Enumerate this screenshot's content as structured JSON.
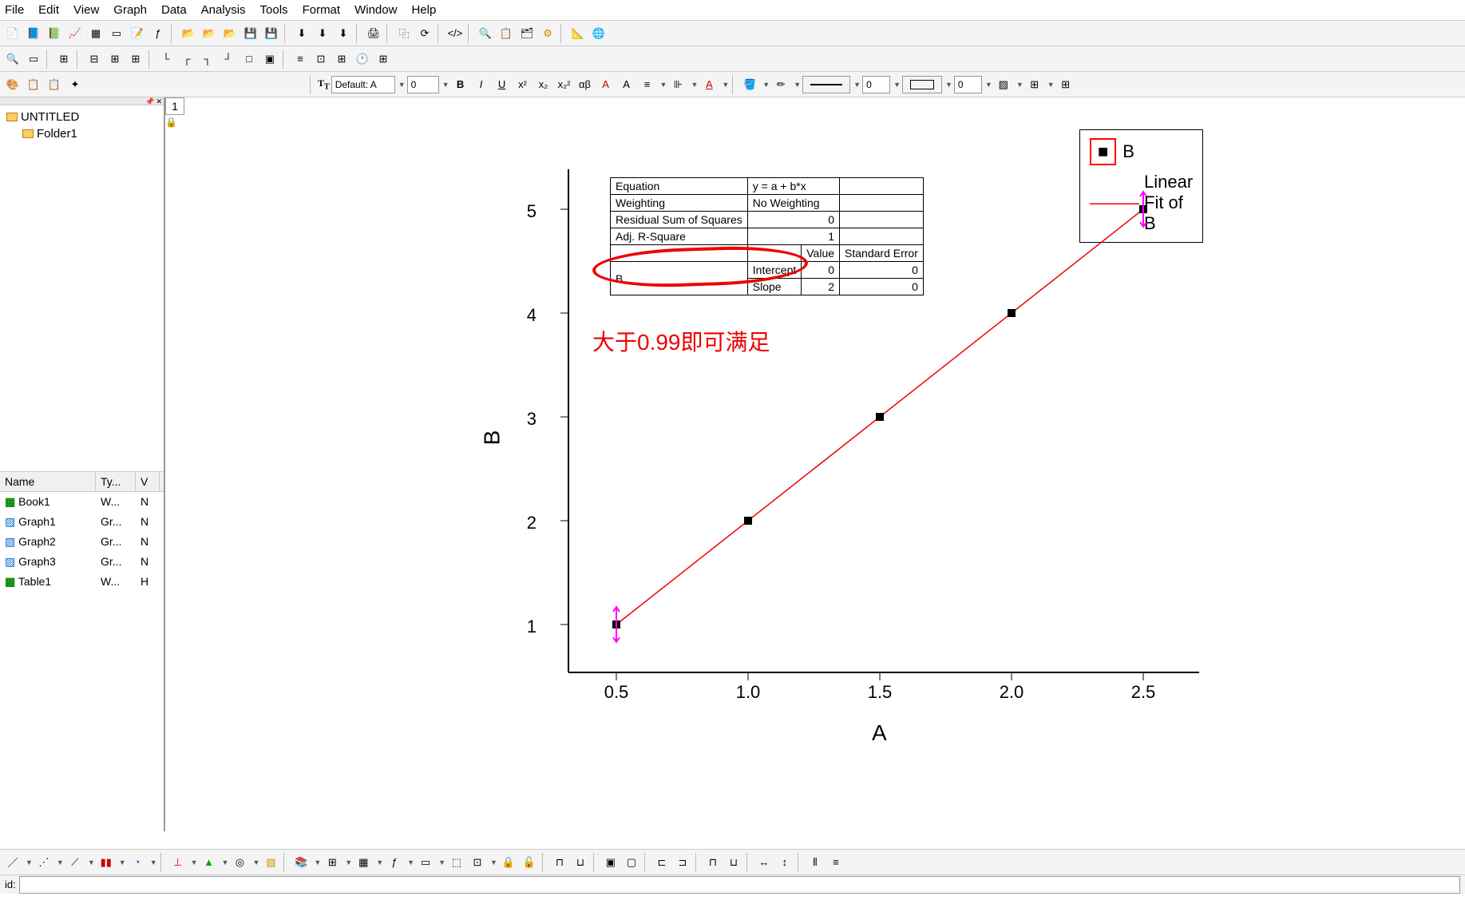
{
  "menu": {
    "items": [
      "File",
      "Edit",
      "View",
      "Graph",
      "Data",
      "Analysis",
      "Tools",
      "Format",
      "Window",
      "Help"
    ]
  },
  "format_toolbar": {
    "font_label": "Default: A",
    "size_value": "0",
    "line_width": "0",
    "border_width": "0"
  },
  "tree": {
    "root": "UNTITLED",
    "folder": "Folder1"
  },
  "list": {
    "headers": [
      "Name",
      "Ty...",
      "V"
    ],
    "rows": [
      {
        "name": "Book1",
        "type": "W...",
        "v": "N"
      },
      {
        "name": "Graph1",
        "type": "Gr...",
        "v": "N"
      },
      {
        "name": "Graph2",
        "type": "Gr...",
        "v": "N"
      },
      {
        "name": "Graph3",
        "type": "Gr...",
        "v": "N"
      },
      {
        "name": "Table1",
        "type": "W...",
        "v": "H"
      }
    ]
  },
  "graph": {
    "page": "1",
    "legend": {
      "series1": "B",
      "series2": "Linear Fit of B"
    },
    "xlabel": "A",
    "ylabel": "B",
    "xticks": [
      "0.5",
      "1.0",
      "1.5",
      "2.0",
      "2.5"
    ],
    "yticks": [
      "1",
      "2",
      "3",
      "4",
      "5"
    ]
  },
  "fit_table": {
    "equation_label": "Equation",
    "equation_val": "y = a + b*x",
    "weight_label": "Weighting",
    "weight_val": "No Weighting",
    "rss_label": "Residual Sum of Squares",
    "rss_val": "0",
    "adjr_label": "Adj. R-Square",
    "adjr_val": "1",
    "value_hdr": "Value",
    "stderr_hdr": "Standard Error",
    "series_name": "B",
    "intercept_label": "Intercept",
    "intercept_val": "0",
    "intercept_err": "0",
    "slope_label": "Slope",
    "slope_val": "2",
    "slope_err": "0"
  },
  "annotation": {
    "text": "大于0.99即可满足"
  },
  "status": {
    "prompt": "id:"
  },
  "chart_data": {
    "type": "scatter-line",
    "title": "",
    "xlabel": "A",
    "ylabel": "B",
    "xlim": [
      0.3,
      2.7
    ],
    "ylim": [
      0.5,
      5.5
    ],
    "series": [
      {
        "name": "B",
        "type": "scatter",
        "x": [
          0.5,
          1.0,
          1.5,
          2.0,
          2.5
        ],
        "y": [
          1,
          2,
          3,
          4,
          5
        ]
      },
      {
        "name": "Linear Fit of B",
        "type": "line",
        "x": [
          0.5,
          2.5
        ],
        "y": [
          1,
          5
        ]
      }
    ],
    "fit": {
      "equation": "y = a + b*x",
      "weighting": "No Weighting",
      "residual_sum_of_squares": 0,
      "adj_r_square": 1,
      "intercept": {
        "value": 0,
        "stderr": 0
      },
      "slope": {
        "value": 2,
        "stderr": 0
      }
    }
  }
}
